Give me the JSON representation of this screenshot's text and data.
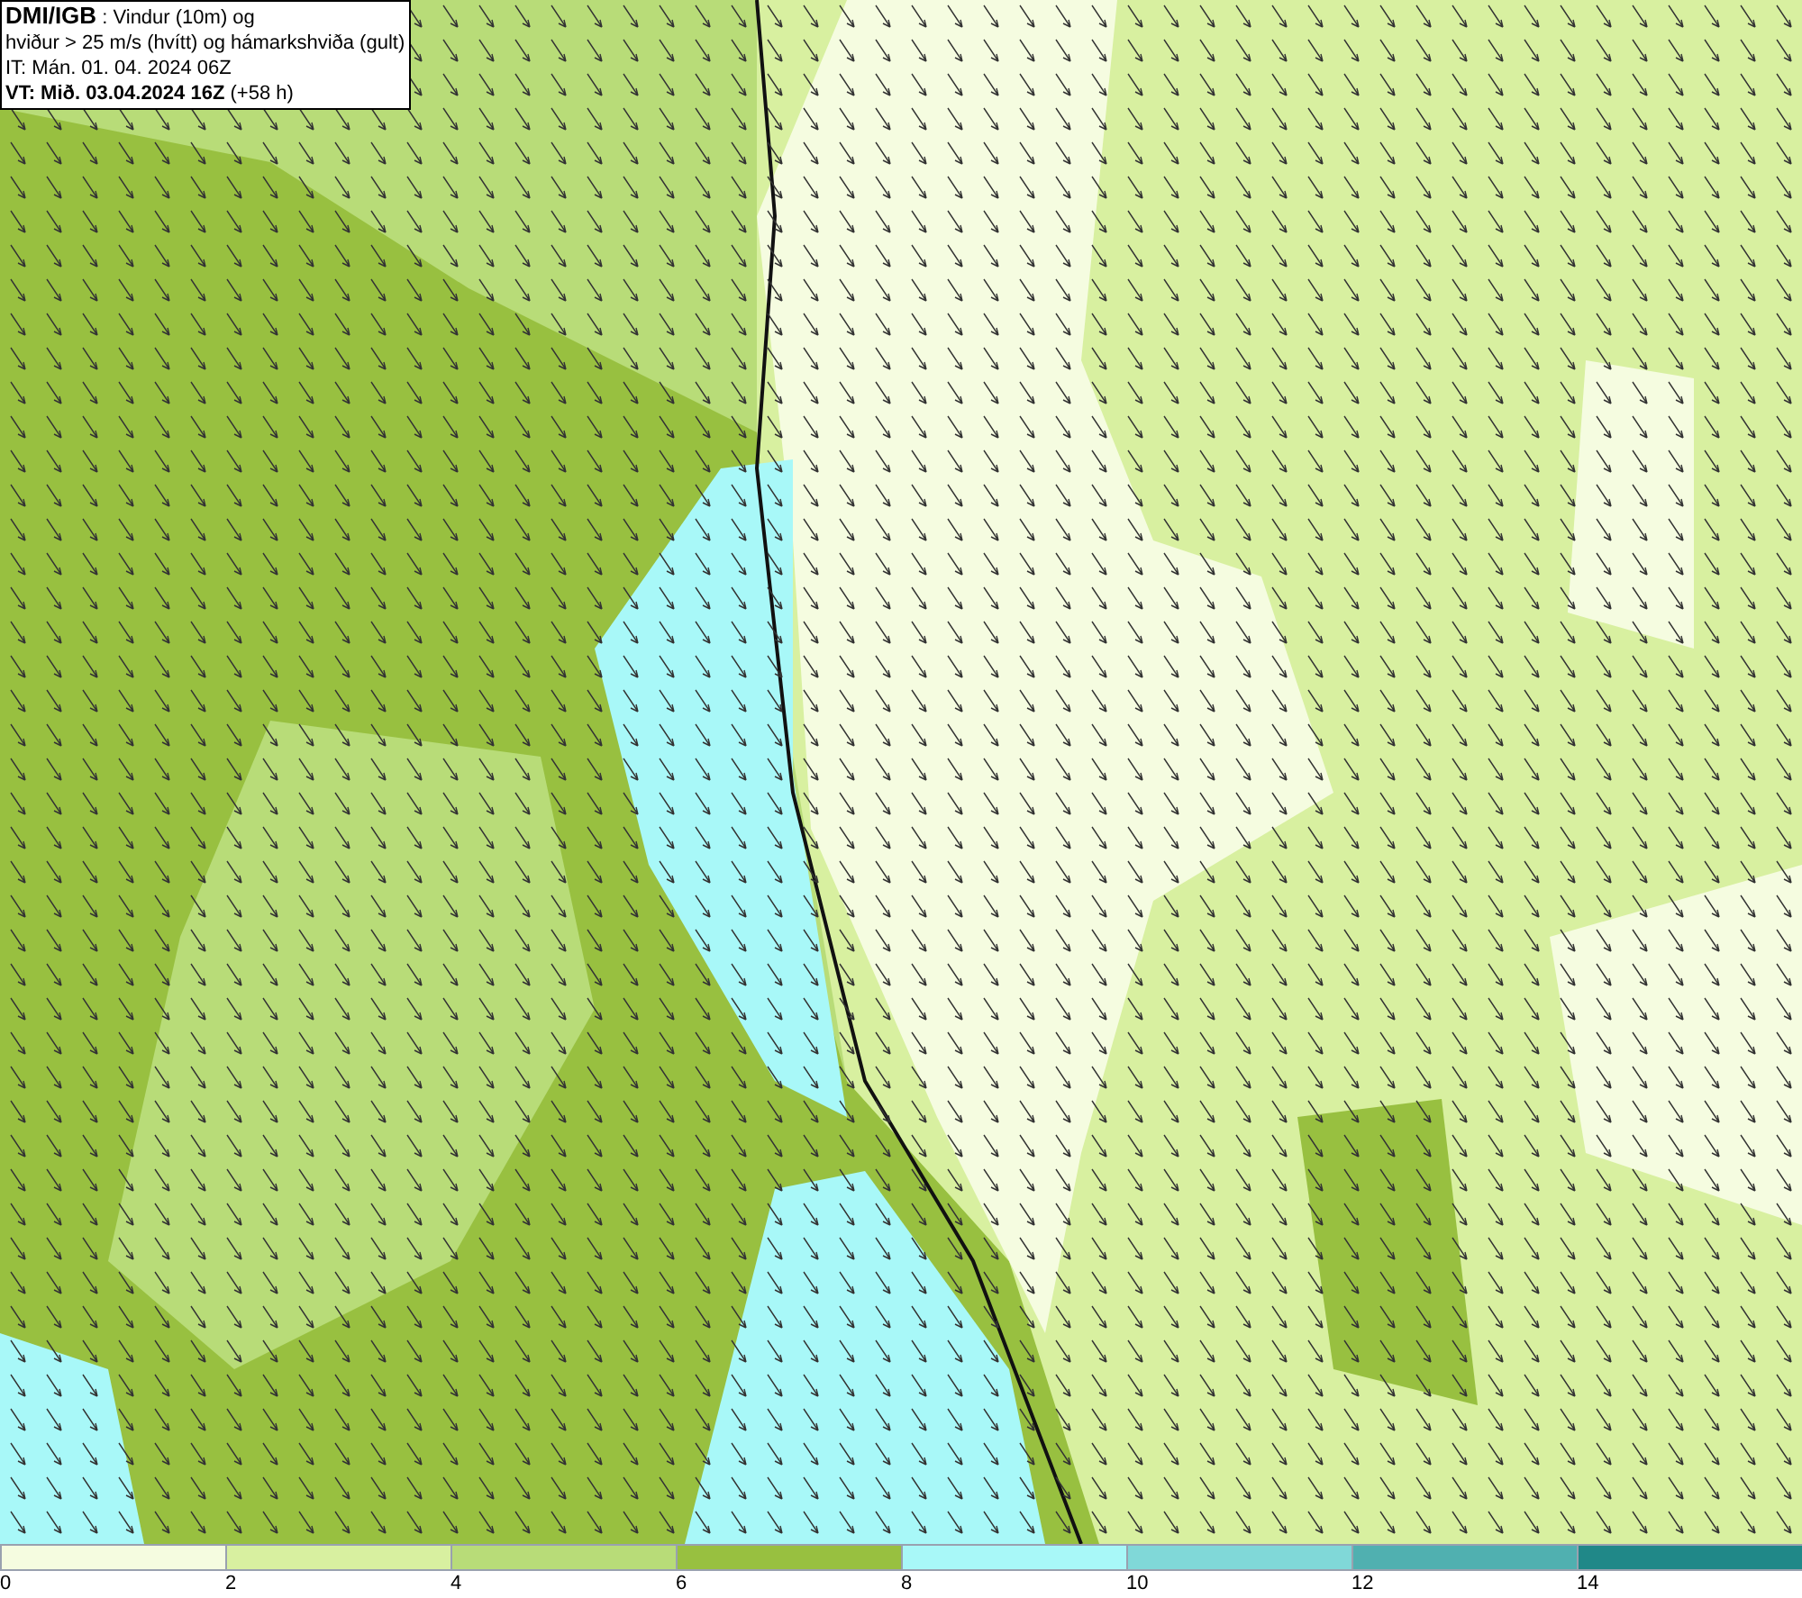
{
  "header": {
    "source": "DMI/IGB",
    "title": ": Vindur (10m) og",
    "subtitle": "hviður > 25 m/s (hvítt) og hámarkshviða (gult)",
    "initial_time": "IT: Mán. 01. 04. 2024 06Z",
    "valid_time": "VT: Mið. 03.04.2024 16Z",
    "lead": "(+58 h)"
  },
  "legend": [
    {
      "label": "0",
      "color": "#f5fce0"
    },
    {
      "label": "2",
      "color": "#d8f0a0"
    },
    {
      "label": "4",
      "color": "#b8dc78"
    },
    {
      "label": "6",
      "color": "#98c040"
    },
    {
      "label": "8",
      "color": "#a8f8f8"
    },
    {
      "label": "10",
      "color": "#80d8d8"
    },
    {
      "label": "12",
      "color": "#50b0b0"
    },
    {
      "label": "14",
      "color": "#208888"
    }
  ]
}
